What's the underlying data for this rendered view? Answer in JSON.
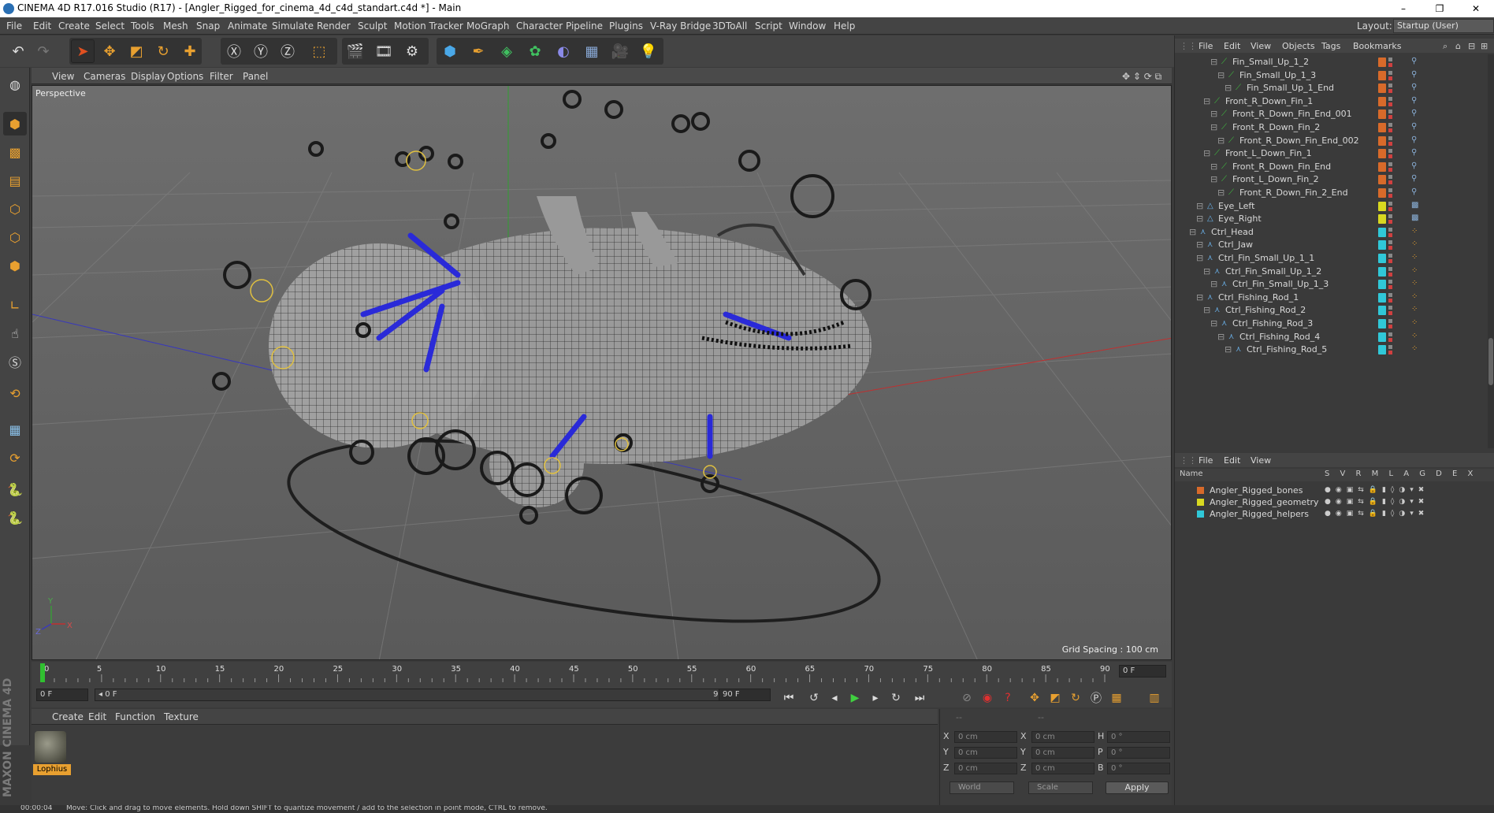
{
  "window": {
    "title": "CINEMA 4D R17.016 Studio (R17) - [Angler_Rigged_for_cinema_4d_c4d_standart.c4d *] - Main",
    "controls": [
      "–",
      "❐",
      "✕"
    ]
  },
  "menubar": {
    "items": [
      "File",
      "Edit",
      "Create",
      "Select",
      "Tools",
      "Mesh",
      "Snap",
      "Animate",
      "Simulate",
      "Render",
      "Sculpt",
      "Motion Tracker",
      "MoGraph",
      "Character",
      "Pipeline",
      "Plugins",
      "V-Ray Bridge",
      "3DToAll",
      "Script",
      "Window",
      "Help"
    ],
    "layout_label": "Layout:",
    "layout_value": "Startup (User)"
  },
  "viewport": {
    "menu": [
      "View",
      "Cameras",
      "Display",
      "Options",
      "Filter",
      "Panel"
    ],
    "label": "Perspective",
    "grid_spacing": "Grid Spacing : 100 cm",
    "axis_labels": [
      "Y",
      "Z",
      "X"
    ]
  },
  "timeline": {
    "ticks": [
      "0",
      "5",
      "10",
      "15",
      "20",
      "25",
      "30",
      "35",
      "40",
      "45",
      "50",
      "55",
      "60",
      "65",
      "70",
      "75",
      "80",
      "85",
      "90"
    ],
    "current_frame": "0 F",
    "start_field": "0 F",
    "range_start": "◂ 0 F",
    "range_end": "90 F ▸",
    "end_field": "90 F"
  },
  "material_panel": {
    "menu": [
      "Create",
      "Edit",
      "Function",
      "Texture"
    ],
    "material_name": "Lophius"
  },
  "coords_panel": {
    "rows": [
      {
        "l1": "X",
        "v1": "0 cm",
        "l2": "X",
        "v2": "0 cm",
        "l3": "H",
        "v3": "0 °"
      },
      {
        "l1": "Y",
        "v1": "0 cm",
        "l2": "Y",
        "v2": "0 cm",
        "l3": "P",
        "v3": "0 °"
      },
      {
        "l1": "Z",
        "v1": "0 cm",
        "l2": "Z",
        "v2": "0 cm",
        "l3": "B",
        "v3": "0 °"
      }
    ],
    "dash1": "--",
    "dash2": "--",
    "world": "World",
    "scale": "Scale",
    "apply": "Apply"
  },
  "object_manager": {
    "menu": [
      "File",
      "Edit",
      "View",
      "Objects",
      "Tags",
      "Bookmarks"
    ],
    "objects": [
      {
        "name": "Fin_Small_Up_1_2",
        "indent": 3,
        "kind": "bone",
        "tag": "#d86a2a"
      },
      {
        "name": "Fin_Small_Up_1_3",
        "indent": 4,
        "kind": "bone",
        "tag": "#d86a2a"
      },
      {
        "name": "Fin_Small_Up_1_End",
        "indent": 5,
        "kind": "bone",
        "tag": "#d86a2a"
      },
      {
        "name": "Front_R_Down_Fin_1",
        "indent": 2,
        "kind": "bone",
        "tag": "#d86a2a"
      },
      {
        "name": "Front_R_Down_Fin_End_001",
        "indent": 3,
        "kind": "bone",
        "tag": "#d86a2a"
      },
      {
        "name": "Front_R_Down_Fin_2",
        "indent": 3,
        "kind": "bone",
        "tag": "#d86a2a"
      },
      {
        "name": "Front_R_Down_Fin_End_002",
        "indent": 4,
        "kind": "bone",
        "tag": "#d86a2a"
      },
      {
        "name": "Front_L_Down_Fin_1",
        "indent": 2,
        "kind": "bone",
        "tag": "#d86a2a"
      },
      {
        "name": "Front_R_Down_Fin_End",
        "indent": 3,
        "kind": "bone",
        "tag": "#d86a2a"
      },
      {
        "name": "Front_L_Down_Fin_2",
        "indent": 3,
        "kind": "bone",
        "tag": "#d86a2a"
      },
      {
        "name": "Front_R_Down_Fin_2_End",
        "indent": 4,
        "kind": "bone",
        "tag": "#d86a2a"
      },
      {
        "name": "Eye_Left",
        "indent": 1,
        "kind": "mesh",
        "tag": "#d8d820"
      },
      {
        "name": "Eye_Right",
        "indent": 1,
        "kind": "mesh",
        "tag": "#d8d820"
      },
      {
        "name": "Ctrl_Head",
        "indent": 0,
        "kind": "ctrl",
        "tag": "#30c8d8"
      },
      {
        "name": "Ctrl_Jaw",
        "indent": 1,
        "kind": "ctrl",
        "tag": "#30c8d8"
      },
      {
        "name": "Ctrl_Fin_Small_Up_1_1",
        "indent": 1,
        "kind": "ctrl",
        "tag": "#30c8d8"
      },
      {
        "name": "Ctrl_Fin_Small_Up_1_2",
        "indent": 2,
        "kind": "ctrl",
        "tag": "#30c8d8"
      },
      {
        "name": "Ctrl_Fin_Small_Up_1_3",
        "indent": 3,
        "kind": "ctrl",
        "tag": "#30c8d8"
      },
      {
        "name": "Ctrl_Fishing_Rod_1",
        "indent": 1,
        "kind": "ctrl",
        "tag": "#30c8d8"
      },
      {
        "name": "Ctrl_Fishing_Rod_2",
        "indent": 2,
        "kind": "ctrl",
        "tag": "#30c8d8"
      },
      {
        "name": "Ctrl_Fishing_Rod_3",
        "indent": 3,
        "kind": "ctrl",
        "tag": "#30c8d8"
      },
      {
        "name": "Ctrl_Fishing_Rod_4",
        "indent": 4,
        "kind": "ctrl",
        "tag": "#30c8d8"
      },
      {
        "name": "Ctrl_Fishing_Rod_5",
        "indent": 5,
        "kind": "ctrl",
        "tag": "#30c8d8"
      }
    ]
  },
  "layer_manager": {
    "menu": [
      "File",
      "Edit",
      "View"
    ],
    "header_name": "Name",
    "header_cols": "S V R M L A G D E X",
    "layers": [
      {
        "name": "Angler_Rigged_bones",
        "color": "#d86a2a"
      },
      {
        "name": "Angler_Rigged_geometry",
        "color": "#d8d820"
      },
      {
        "name": "Angler_Rigged_helpers",
        "color": "#30c8d8"
      }
    ]
  },
  "statusbar": {
    "time": "00:00:04",
    "message": "Move: Click and drag to move elements. Hold down SHIFT to quantize movement / add to the selection in point mode, CTRL to remove."
  },
  "brand": {
    "text": "MAXON CINEMA 4D"
  }
}
